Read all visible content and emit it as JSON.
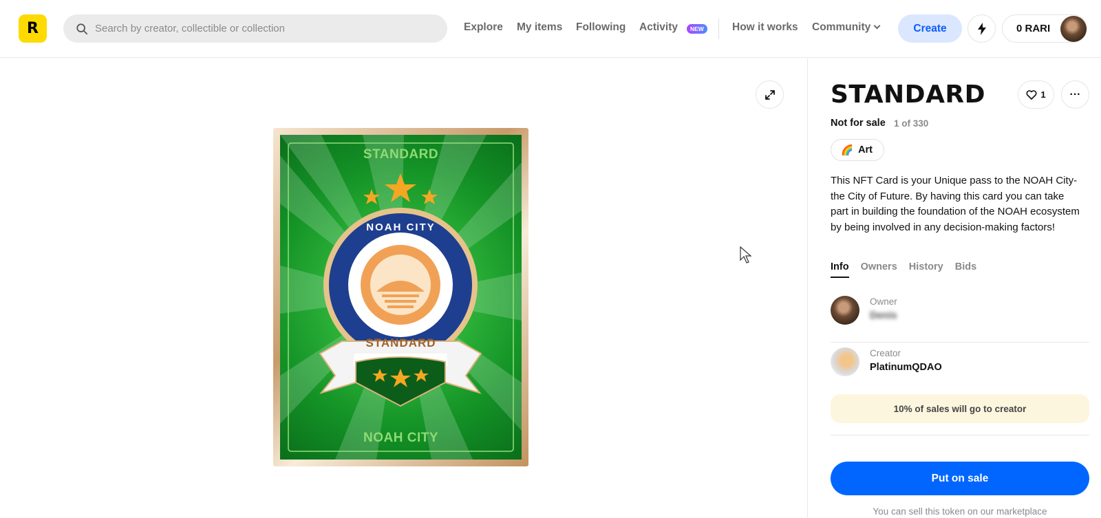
{
  "header": {
    "logo_letter": "R",
    "search_placeholder": "Search by creator, collectible or collection",
    "nav": {
      "explore": "Explore",
      "my_items": "My items",
      "following": "Following",
      "activity": "Activity",
      "activity_badge": "NEW",
      "how_it_works": "How it works",
      "community": "Community"
    },
    "create_label": "Create",
    "wallet_balance": "0 RARI"
  },
  "card": {
    "top_text": "STANDARD",
    "ring_text": "NOAH CITY",
    "ribbon_text": "STANDARD",
    "bottom_text": "NOAH CITY"
  },
  "item": {
    "title": "STANDARD",
    "likes": "1",
    "sale_status": "Not for sale",
    "edition": "1 of 330",
    "category_emoji": "🌈",
    "category": "Art",
    "description": "This NFT Card is your Unique pass to the NOAH City- the City of Future. By having this card you can take part in building the foundation of the NOAH ecosystem by being involved in any decision-making factors!",
    "tabs": [
      "Info",
      "Owners",
      "History",
      "Bids"
    ],
    "owner_role": "Owner",
    "owner_name": "Denis",
    "creator_role": "Creator",
    "creator_name": "PlatinumQDAO",
    "royalty_note": "10% of sales will go to creator",
    "put_on_sale_label": "Put on sale",
    "sell_note": "You can sell this token on our marketplace"
  },
  "colors": {
    "accent": "#0066ff",
    "logo_bg": "#FEDA03",
    "create_bg": "#dbe7ff",
    "royalty_bg": "#fdf6de"
  }
}
